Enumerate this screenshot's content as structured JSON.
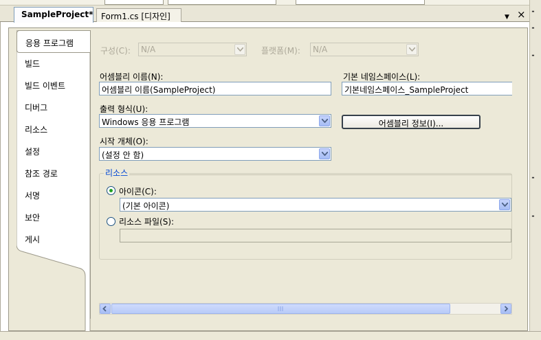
{
  "tabs": {
    "active_label": "SampleProject*",
    "second_label": "Form1.cs [디자인]"
  },
  "nav": {
    "items": [
      "응용 프로그램",
      "빌드",
      "빌드 이벤트",
      "디버그",
      "리소스",
      "설정",
      "참조 경로",
      "서명",
      "보안",
      "게시"
    ]
  },
  "config": {
    "config_label": "구성(C):",
    "config_value": "N/A",
    "platform_label": "플랫폼(M):",
    "platform_value": "N/A"
  },
  "app": {
    "assembly_name_label": "어셈블리 이름(N):",
    "assembly_name_value": "어셈블리 이름(SampleProject)",
    "namespace_label": "기본 네임스페이스(L):",
    "namespace_value": "기본네임스페이스_SampleProject",
    "output_type_label": "출력 형식(U):",
    "output_type_value": "Windows 응용 프로그램",
    "assembly_info_button": "어셈블리 정보(I)...",
    "startup_object_label": "시작 개체(O):",
    "startup_object_value": "(설정 안 함)"
  },
  "resources": {
    "group_title": "리소스",
    "icon_label": "아이콘(C):",
    "icon_value": "(기본 아이콘)",
    "resource_file_label": "리소스 파일(S):",
    "resource_file_value": ""
  },
  "colors": {
    "group_title": "#0046d5",
    "background": "#ece9d8",
    "radio_dot": "#21a121"
  }
}
